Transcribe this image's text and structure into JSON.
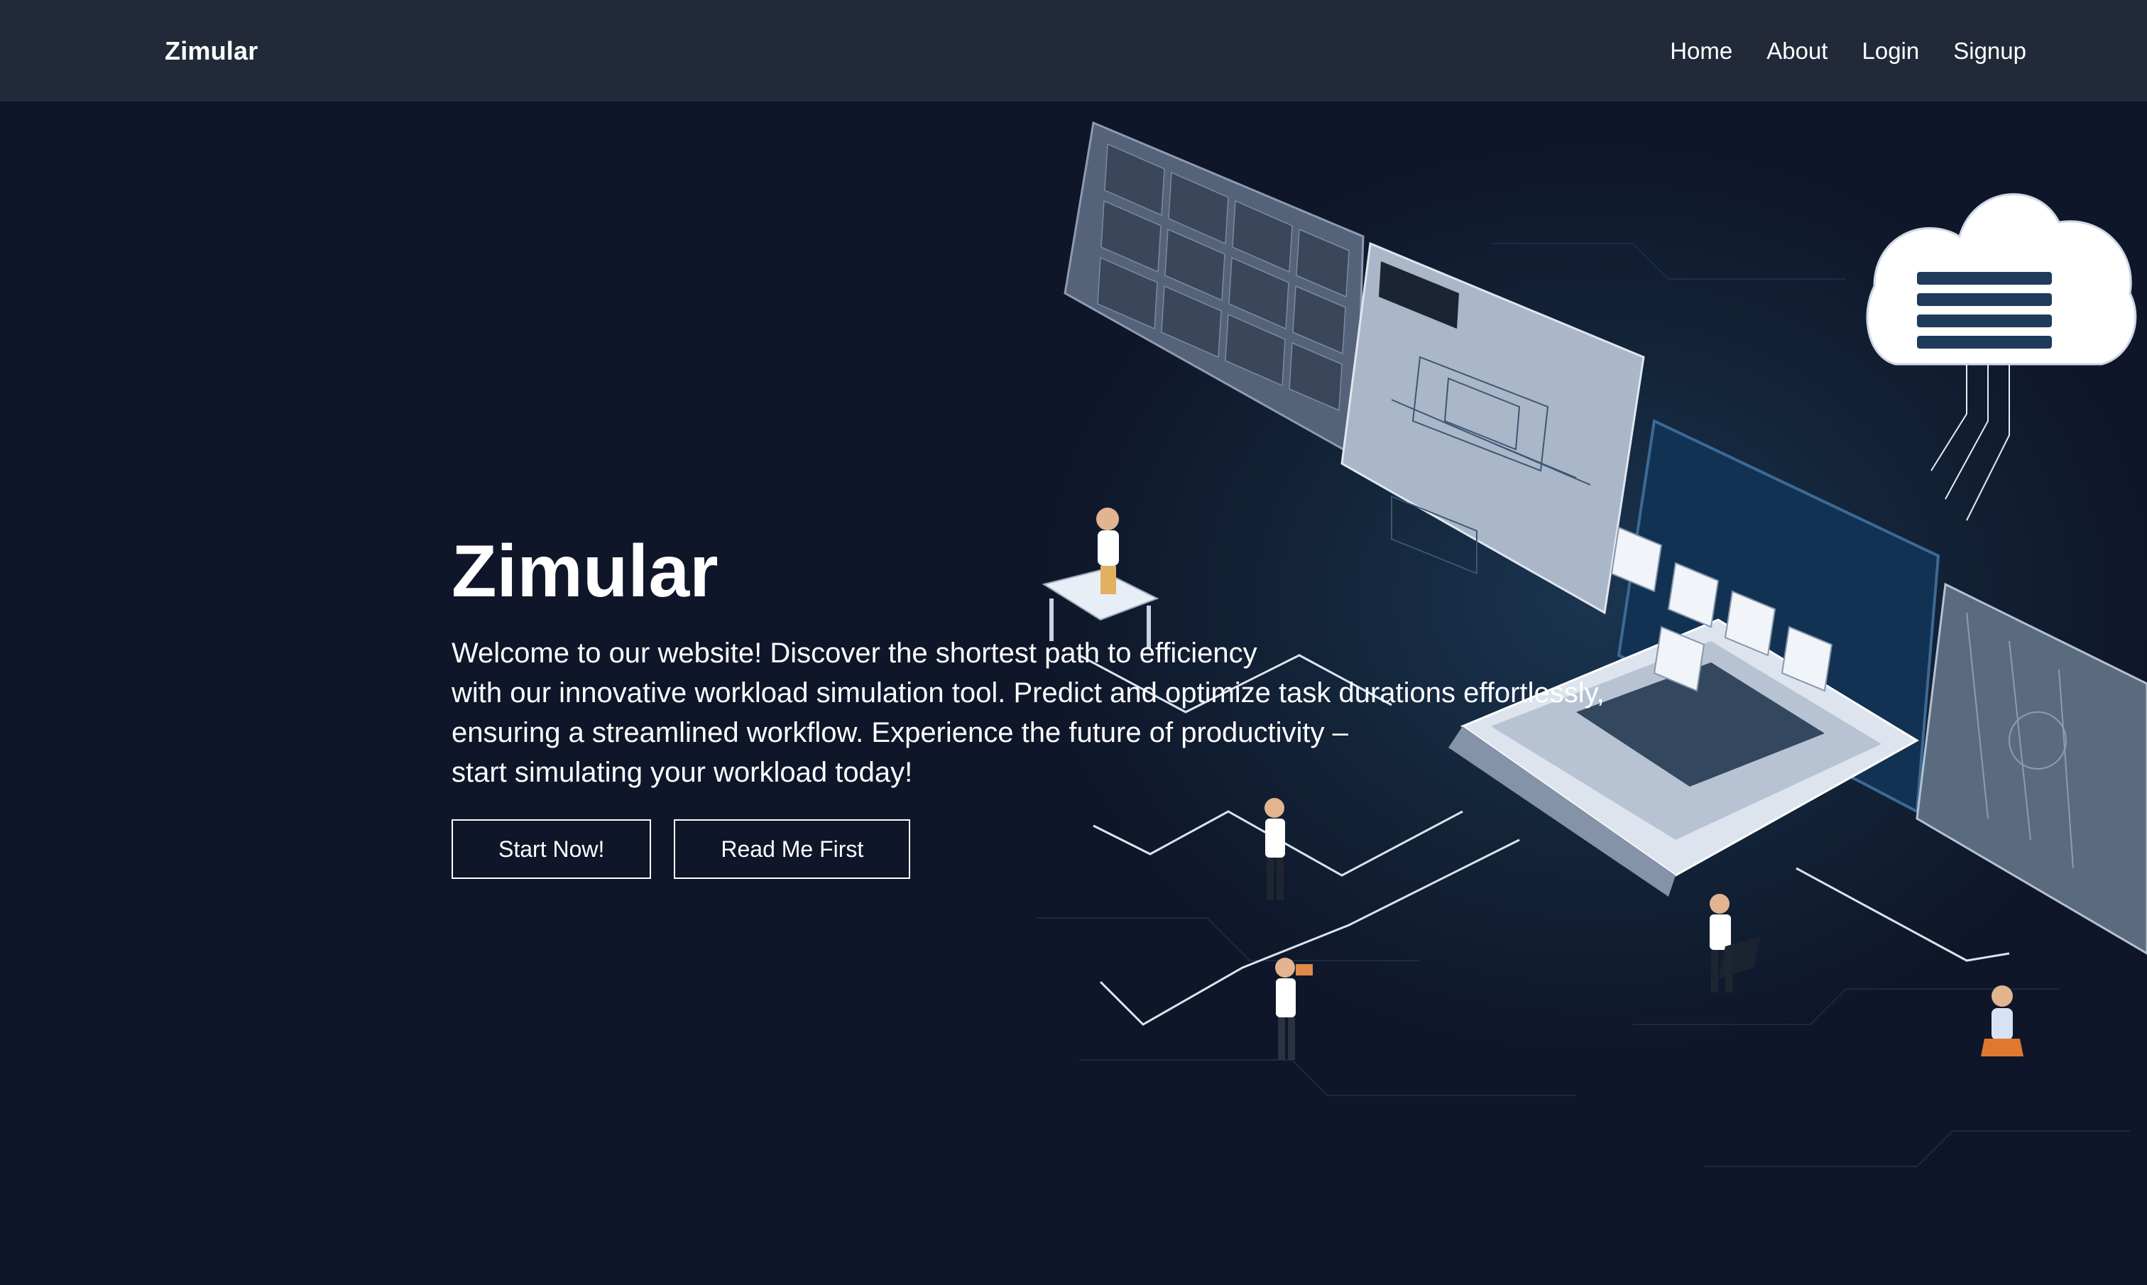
{
  "navbar": {
    "brand": "Zimular",
    "links": [
      "Home",
      "About",
      "Login",
      "Signup"
    ]
  },
  "hero": {
    "title": "Zimular",
    "description": "Welcome to our website! Discover the shortest path to efficiency\nwith our innovative workload simulation tool. Predict and optimize task durations effortlessly,\nensuring a streamlined workflow. Experience the future of productivity –\nstart simulating your workload today!",
    "buttons": {
      "start": "Start Now!",
      "read": "Read Me First"
    }
  },
  "colors": {
    "navbar_bg": "#222938",
    "page_bg": "#0f1629",
    "text": "#ffffff"
  }
}
